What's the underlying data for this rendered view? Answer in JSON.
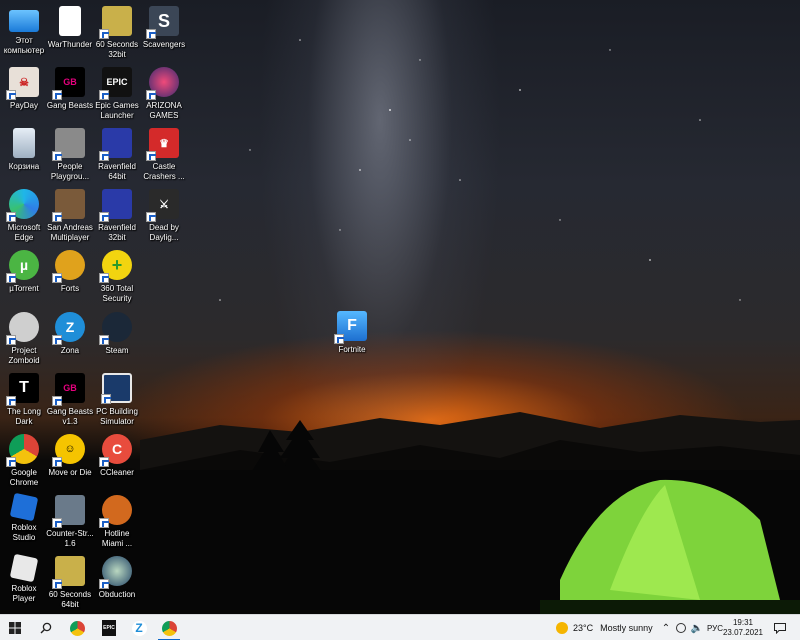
{
  "desktop": {
    "icons": [
      {
        "label": "Этот компьютер",
        "icon": "this-pc-icon"
      },
      {
        "label": "WarThunder",
        "icon": "file-icon"
      },
      {
        "label": "60 Seconds 32bit",
        "icon": "sixty-seconds-icon"
      },
      {
        "label": "Scavengers",
        "icon": "scavengers-icon"
      },
      {
        "label": "PayDay",
        "icon": "payday-icon"
      },
      {
        "label": "Gang Beasts",
        "icon": "gang-beasts-icon"
      },
      {
        "label": "Epic Games Launcher",
        "icon": "epic-games-icon"
      },
      {
        "label": "ARIZONA GAMES",
        "icon": "arizona-games-icon"
      },
      {
        "label": "Корзина",
        "icon": "recycle-bin-icon"
      },
      {
        "label": "People Playgrou...",
        "icon": "people-playground-icon"
      },
      {
        "label": "Ravenfield 64bit",
        "icon": "ravenfield-icon"
      },
      {
        "label": "Castle Crashers ...",
        "icon": "castle-crashers-icon"
      },
      {
        "label": "Microsoft Edge",
        "icon": "edge-icon"
      },
      {
        "label": "San Andreas Multiplayer",
        "icon": "samp-icon"
      },
      {
        "label": "Ravenfield 32bit",
        "icon": "ravenfield-icon"
      },
      {
        "label": "Dead by Daylig...",
        "icon": "dead-by-daylight-icon"
      },
      {
        "label": "µTorrent",
        "icon": "utorrent-icon"
      },
      {
        "label": "Forts",
        "icon": "forts-icon"
      },
      {
        "label": "360 Total Security",
        "icon": "total-security-icon"
      },
      {
        "label": "Project Zomboid",
        "icon": "project-zomboid-icon"
      },
      {
        "label": "Zona",
        "icon": "zona-icon"
      },
      {
        "label": "Steam",
        "icon": "steam-icon"
      },
      {
        "label": "The Long Dark",
        "icon": "the-long-dark-icon"
      },
      {
        "label": "Gang Beasts v1.3",
        "icon": "gang-beasts-icon"
      },
      {
        "label": "PC Building Simulator",
        "icon": "pc-building-simulator-icon"
      },
      {
        "label": "Google Chrome",
        "icon": "chrome-icon"
      },
      {
        "label": "Move or Die",
        "icon": "move-or-die-icon"
      },
      {
        "label": "CCleaner",
        "icon": "ccleaner-icon"
      },
      {
        "label": "Roblox Studio",
        "icon": "roblox-studio-icon"
      },
      {
        "label": "Counter-Str... 1.6",
        "icon": "counter-strike-icon"
      },
      {
        "label": "Hotline Miami ...",
        "icon": "hotline-miami-icon"
      },
      {
        "label": "Roblox Player",
        "icon": "roblox-player-icon"
      },
      {
        "label": "60 Seconds 64bit",
        "icon": "sixty-seconds-icon"
      },
      {
        "label": "Obduction",
        "icon": "obduction-icon"
      },
      {
        "label": "Fortnite",
        "icon": "fortnite-icon"
      }
    ]
  },
  "taskbar": {
    "pinned": [
      {
        "icon": "start-windows-icon"
      },
      {
        "icon": "search-icon"
      },
      {
        "icon": "chrome-icon"
      },
      {
        "icon": "epic-games-icon"
      },
      {
        "icon": "zona-icon"
      },
      {
        "icon": "chrome-alt-icon"
      }
    ],
    "weather": {
      "temp": "23°C",
      "condition": "Mostly sunny"
    },
    "language": "РУС",
    "time": "19:31",
    "date": "23.07.2021"
  }
}
